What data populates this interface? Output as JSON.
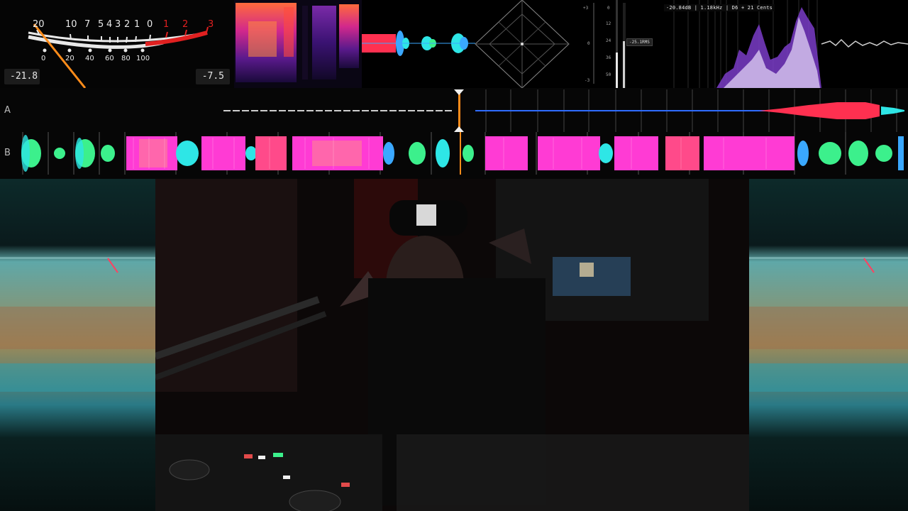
{
  "vu_meter": {
    "scale_top": [
      "20",
      "10",
      "7",
      "5",
      "4",
      "3",
      "2",
      "1",
      "0",
      "1",
      "2",
      "3"
    ],
    "scale_bottom": [
      "0",
      "20",
      "40",
      "60",
      "80",
      "100"
    ],
    "left_readout": "-21.8",
    "right_readout": "-7.5",
    "red_color": "#e02020",
    "needle_color": "#ff8c1a"
  },
  "level_meter": {
    "left_scale": [
      "+3",
      "0",
      "-3"
    ],
    "right_scale": [
      "0",
      "12",
      "24",
      "36",
      "50"
    ],
    "rms_badge": "-25.1RMS"
  },
  "tuner": {
    "readout": "-20.84dB | 1.18kHz | D6  + 21 Cents"
  },
  "decks": [
    {
      "label": "A"
    },
    {
      "label": "B"
    }
  ],
  "colors": {
    "accent_magenta": "#ff3bd4",
    "accent_cyan": "#2ee6e6",
    "accent_red": "#ff3050",
    "accent_green": "#3cf08c"
  }
}
